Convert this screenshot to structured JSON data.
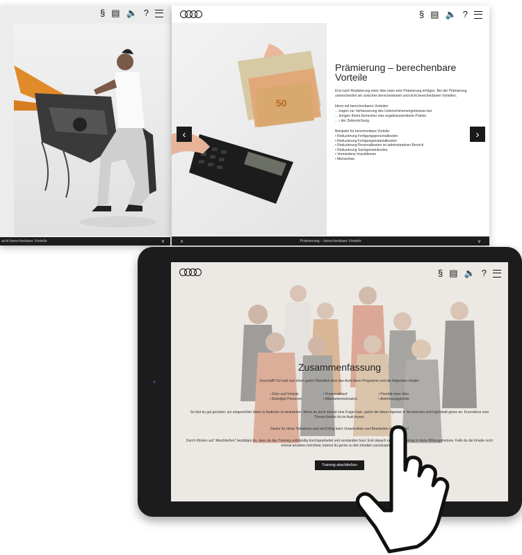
{
  "left_screen": {
    "icons": [
      "paragraph-icon",
      "notes-icon",
      "speaker-icon",
      "help-icon",
      "menu-icon"
    ],
    "footer_label": "acht berechenbare Vorteile"
  },
  "center_screen": {
    "title": "Prämierung – berechenbare Vorteile",
    "intro": "Erst nach Realisierung einer Idee kann eine Prämierung erfolgen. Bei der Prämierung unterscheiden wir zwischen berechenbaren und nicht berechenbaren Vorteilen.",
    "calc_label": "Ideen mit berechenbaren Vorteilen",
    "calc_lines": [
      "... tragen zur Verbesserung des Unternehmensergebnisses bei.",
      "... bringen Ihrem Einreicher eine ergebnisorientierte Prämie.",
      "... r der Zielerreichung."
    ],
    "examples_label": "Beispiele für berechenbare Vorteile:",
    "examples": [
      "• Reduzierung Fertigungspersonalkosten",
      "• Reduzierung Fertigungsmaterialkosten",
      "• Reduzierung Personalkosten im administrativen Bereich",
      "• Reduzierung Sachgemeinkosten",
      "• Vermiedene Investitionen",
      "• Mehrerlöse"
    ],
    "footer_label": "Prämierung – berechenbare Vorteile",
    "prev": "‹",
    "next": "›"
  },
  "tablet": {
    "title": "Zusammenfassung",
    "intro": "Geschafft! Du hast nun einen guten Überblick über das Audi Ideen-Programm und die folgenden Inhalte:",
    "topics_col1": [
      "• Ziele und Vorteile",
      "• Beteiligte Personen"
    ],
    "topics_col2": [
      "• Prozessablauf",
      "• Mitarbeitermotivation"
    ],
    "topics_col3": [
      "• Priorität einer Idee",
      "• Ablehnungsgründe"
    ],
    "para1": "So bist du gut gerüstet, um eingereichte Ideen in Audimax zu bearbeiten. Wenn du doch einmal eine Frage hast, sprich die Ideen-Agentur in Neckarsulm und Ingolstadt gerne an. Kurzvideos zum Thema findest du im Audi mynet.",
    "para2": "Danke für deine Teilnahme und viel Erfolg beim Vorantreiben und Bearbeiten neuer Ideen!",
    "para3": "Durch Klicken auf \"Abschließen\" bestätigst du, dass du das Training vollständig durchgearbeitet und verstanden hast. Erst danach erfolgt der Eintrag in deine Bildungshistorie. Falls du die Inhalte noch einmal ansehen möchtest, kannst du gerne zu den Inhalten zurückspringen.",
    "button": "Training abschließen"
  },
  "colors": {
    "accent": "#bb0a30",
    "dark": "#1a1a1a"
  }
}
